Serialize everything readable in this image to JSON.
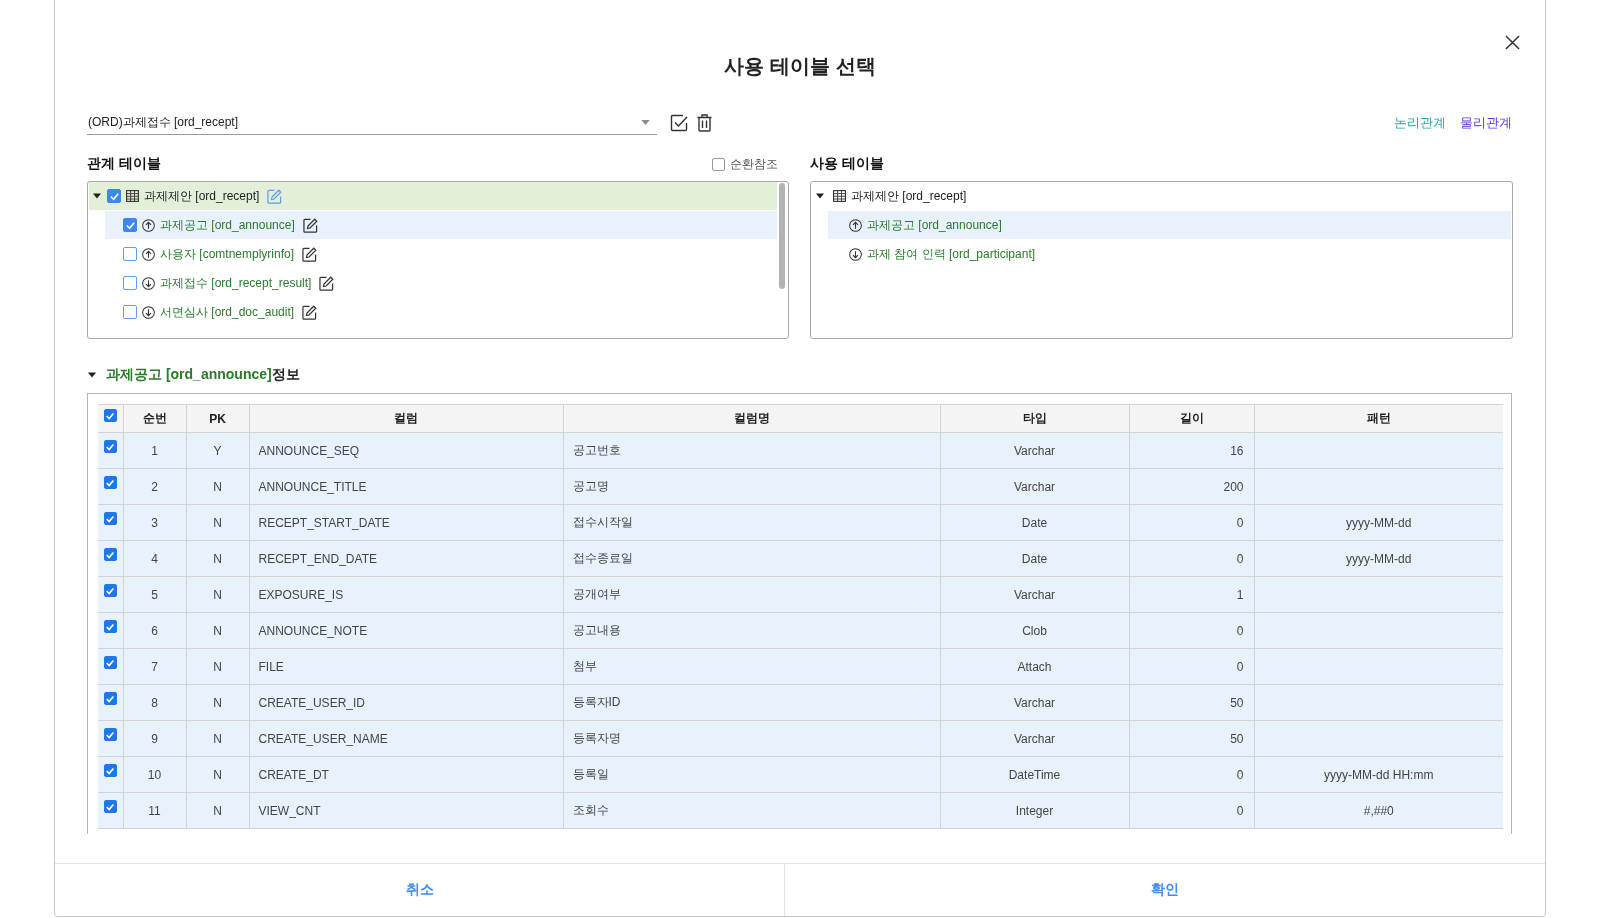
{
  "dialog": {
    "title": "사용 테이블 선택"
  },
  "table_select": {
    "value": "(ORD)과제접수 [ord_recept]"
  },
  "relation_links": [
    {
      "label": "논리관계",
      "color": "#1ea7a7"
    },
    {
      "label": "물리관계",
      "color": "#5a2ff2"
    }
  ],
  "related_tables": {
    "title": "관계 테이블",
    "circular_reference": {
      "label": "순환참조",
      "checked": false
    },
    "tree": [
      {
        "label": "과제제안 [ord_recept]",
        "kind": "table",
        "checked": true,
        "expanded": true,
        "selected": false,
        "highlighted": true,
        "children": [
          {
            "label": "과제공고 [ord_announce]",
            "kind": "up",
            "checked": true,
            "selected": true
          },
          {
            "label": "사용자 [comtnemplyrinfo]",
            "kind": "up",
            "checked": false,
            "selected": false
          },
          {
            "label": "과제접수 [ord_recept_result]",
            "kind": "down",
            "checked": false,
            "selected": false
          },
          {
            "label": "서면심사 [ord_doc_audit]",
            "kind": "down",
            "checked": false,
            "selected": false
          }
        ]
      }
    ]
  },
  "used_tables": {
    "title": "사용 테이블",
    "tree": [
      {
        "label": "과제제안 [ord_recept]",
        "kind": "table",
        "expanded": true,
        "selected": false,
        "children": [
          {
            "label": "과제공고 [ord_announce]",
            "kind": "up",
            "selected": true
          },
          {
            "label": "과제 참여 인력 [ord_participant]",
            "kind": "down",
            "selected": false
          }
        ]
      }
    ]
  },
  "detail": {
    "expanded": true,
    "table_name": "과제공고 [ord_announce]",
    "suffix": "정보",
    "all_checked": true,
    "columns": [
      "순번",
      "PK",
      "컬럼",
      "컬럼명",
      "타입",
      "길이",
      "패턴"
    ],
    "rows": [
      {
        "checked": true,
        "seq": "1",
        "pk": "Y",
        "column": "ANNOUNCE_SEQ",
        "name": "공고번호",
        "type": "Varchar",
        "length": "16"
      },
      {
        "checked": true,
        "seq": "2",
        "pk": "N",
        "column": "ANNOUNCE_TITLE",
        "name": "공고명",
        "type": "Varchar",
        "length": "200"
      },
      {
        "checked": true,
        "seq": "3",
        "pk": "N",
        "column": "RECEPT_START_DATE",
        "name": "접수시작일",
        "type": "Date",
        "length": "0",
        "pattern": "yyyy-MM-dd"
      },
      {
        "checked": true,
        "seq": "4",
        "pk": "N",
        "column": "RECEPT_END_DATE",
        "name": "접수종료일",
        "type": "Date",
        "length": "0",
        "pattern": "yyyy-MM-dd"
      },
      {
        "checked": true,
        "seq": "5",
        "pk": "N",
        "column": "EXPOSURE_IS",
        "name": "공개여부",
        "type": "Varchar",
        "length": "1"
      },
      {
        "checked": true,
        "seq": "6",
        "pk": "N",
        "column": "ANNOUNCE_NOTE",
        "name": "공고내용",
        "type": "Clob",
        "length": "0"
      },
      {
        "checked": true,
        "seq": "7",
        "pk": "N",
        "column": "FILE",
        "name": "첨부",
        "type": "Attach",
        "length": "0"
      },
      {
        "checked": true,
        "seq": "8",
        "pk": "N",
        "column": "CREATE_USER_ID",
        "name": "등록자ID",
        "type": "Varchar",
        "length": "50"
      },
      {
        "checked": true,
        "seq": "9",
        "pk": "N",
        "column": "CREATE_USER_NAME",
        "name": "등록자명",
        "type": "Varchar",
        "length": "50"
      },
      {
        "checked": true,
        "seq": "10",
        "pk": "N",
        "column": "CREATE_DT",
        "name": "등록일",
        "type": "DateTime",
        "length": "0",
        "pattern": "yyyy-MM-dd HH:mm"
      },
      {
        "checked": true,
        "seq": "11",
        "pk": "N",
        "column": "VIEW_CNT",
        "name": "조회수",
        "type": "Integer",
        "length": "0",
        "pattern": "#,##0"
      }
    ]
  },
  "buttons": [
    "취소",
    "확인"
  ]
}
